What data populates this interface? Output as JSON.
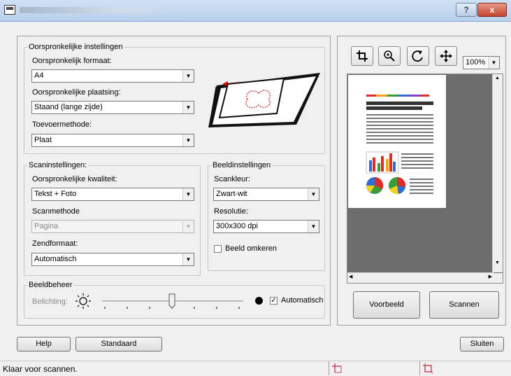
{
  "window": {
    "help_button": "?",
    "close_button": "x"
  },
  "original_settings": {
    "legend": "Oorspronkelijke instellingen",
    "format_label": "Oorspronkelijk formaat:",
    "format_value": "A4",
    "placement_label": "Oorspronkelijke plaatsing:",
    "placement_value": "Staand (lange zijde)",
    "feed_label": "Toevoermethode:",
    "feed_value": "Plaat"
  },
  "scan_settings": {
    "legend": "Scaninstellingen:",
    "quality_label": "Oorspronkelijke kwaliteit:",
    "quality_value": "Tekst + Foto",
    "method_label": "Scanmethode",
    "method_value": "Pagina",
    "send_format_label": "Zendformaat:",
    "send_format_value": "Automatisch"
  },
  "image_settings": {
    "legend": "Beeldinstellingen",
    "color_label": "Scankleur:",
    "color_value": "Zwart-wit",
    "resolution_label": "Resolutie:",
    "resolution_value": "300x300 dpi",
    "invert_label": "Beeld omkeren",
    "invert_checked": false
  },
  "image_management": {
    "legend": "Beeldbeheer",
    "exposure_label": "Belichting:",
    "exposure_level": 0.5,
    "auto_label": "Automatisch",
    "auto_checked": true
  },
  "preview": {
    "tools": [
      "crop-icon",
      "zoom-in-icon",
      "rotate-icon",
      "move-icon"
    ],
    "zoom_value": "100%",
    "preview_button": "Voorbeeld",
    "scan_button": "Scannen"
  },
  "footer": {
    "help_button": "Help",
    "defaults_button": "Standaard",
    "close_button": "Sluiten"
  },
  "status": {
    "text": "Klaar voor scannen."
  }
}
